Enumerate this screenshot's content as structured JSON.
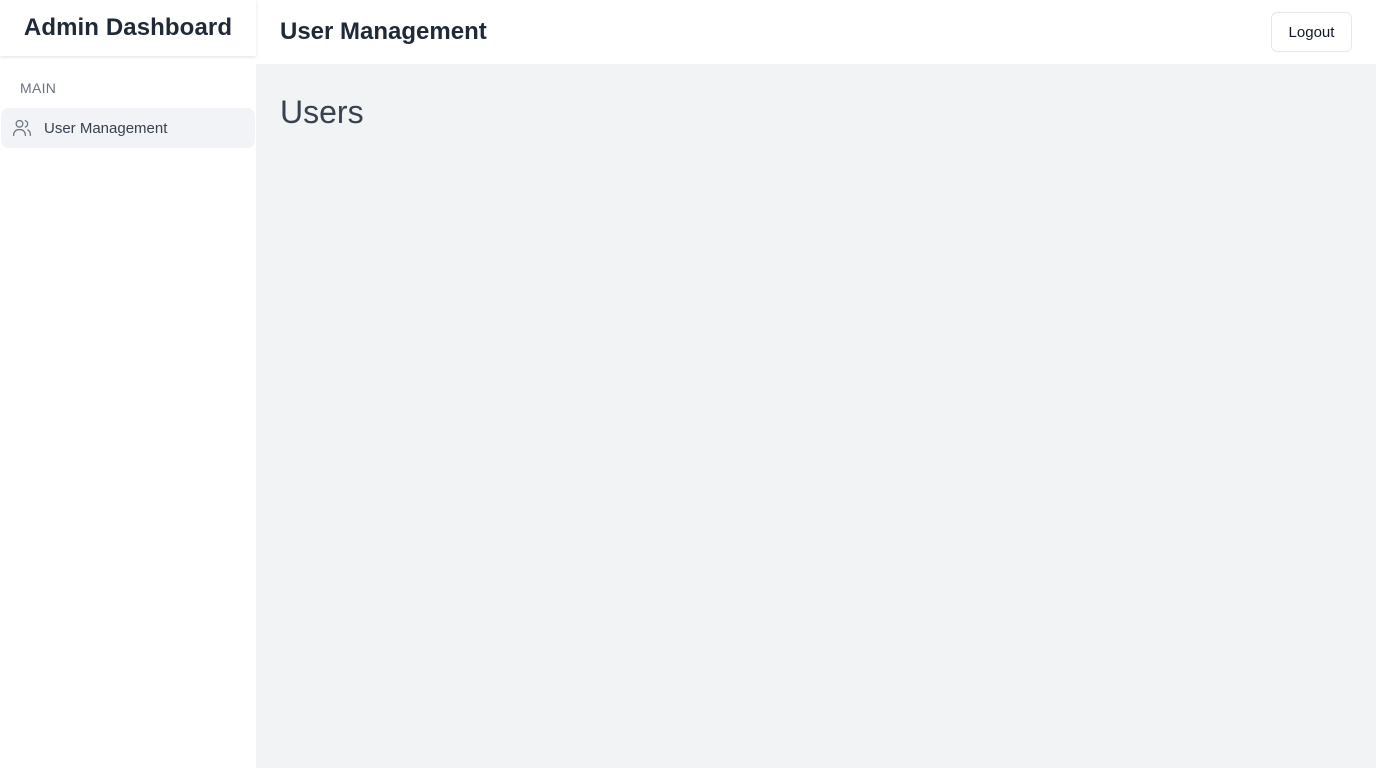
{
  "sidebar": {
    "brand": "Admin Dashboard",
    "section_label": "MAIN",
    "items": [
      {
        "label": "User Management",
        "icon": "users-icon",
        "active": true
      }
    ]
  },
  "header": {
    "title": "User Management",
    "logout_label": "Logout"
  },
  "main": {
    "page_title": "Users"
  },
  "colors": {
    "sidebar_bg": "#ffffff",
    "main_bg": "#f2f3f5",
    "active_item_bg": "#f1f3f6",
    "text_primary": "#1f2937",
    "text_muted": "#6b7280"
  }
}
